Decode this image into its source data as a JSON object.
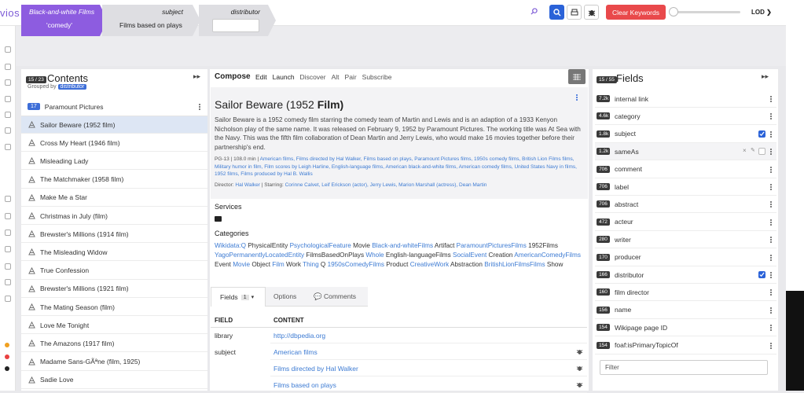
{
  "app": {
    "logo": "vios"
  },
  "topbar": {
    "search_text": "comedy",
    "clear_keywords": "Clear Keywords",
    "lod_label": "LOD"
  },
  "crumbs": [
    {
      "title": "Black-and-white Films",
      "value": "'comedy'"
    },
    {
      "title": "subject",
      "value": "Films based on plays"
    },
    {
      "title": "distributor",
      "value": ""
    }
  ],
  "contents": {
    "count": "15 / 23",
    "title": "Contents",
    "grouped_by_label": "Grouped by",
    "grouped_by_value": "distributor",
    "group": {
      "count": "17",
      "label": "Paramount Pictures"
    },
    "items": [
      "Sailor Beware (1952 film)",
      "Cross My Heart (1946 film)",
      "Misleading Lady",
      "The Matchmaker (1958 film)",
      "Make Me a Star",
      "Christmas in July (film)",
      "Brewster's Millions (1914 film)",
      "The Misleading Widow",
      "True Confession",
      "Brewster's Millions (1921 film)",
      "The Mating Season (film)",
      "Love Me Tonight",
      "The Amazons (1917 film)",
      "Madame Sans-GÃªne (film, 1925)",
      "Sadie Love"
    ]
  },
  "compose": {
    "title": "Compose",
    "tabs": [
      "Edit",
      "Launch",
      "Discover",
      "Alt",
      "Pair",
      "Subscribe"
    ],
    "heading_plain": "Sailor Beware (1952 ",
    "heading_bold": "Film)",
    "abstract": "Sailor Beware is a 1952 comedy film starring the comedy team of Martin and Lewis and is an adaption of a 1933 Kenyon Nicholson play of the same name. It was released on February 9, 1952 by Paramount Pictures. The working title was At Sea with the Navy. This was the fifth film collaboration of Dean Martin and Jerry Lewis, who would make 16 movies together before their partnership's end.",
    "meta_prefix": "PG-13 | 108.0 min | ",
    "meta_links": "American films, Films directed by Hal Walker, Films based on plays, Paramount Pictures films, 1950s comedy films, British Lion Films films, Military humor in film, Film scores by Leigh Harline, English-language films, American black-and-white films, American comedy films, United States Navy in films, 1952 films, Films produced by Hal B. Wallis",
    "director_label": "Director: ",
    "director": "Hal Walker",
    "starring_label": " | Starring: ",
    "starring": "Corinne Calvet, Leif Erickson (actor), Jerry Lewis, Marion Marshall (actress), Dean Martin",
    "services_label": "Services",
    "categories_label": "Categories",
    "categories": [
      {
        "t": "Wikidata:Q",
        "l": true
      },
      {
        "t": "PhysicalEntity",
        "l": false
      },
      {
        "t": "PsychologicalFeature",
        "l": true
      },
      {
        "t": "Movie",
        "l": false
      },
      {
        "t": "Black-and-whiteFilms",
        "l": true
      },
      {
        "t": "Artifact",
        "l": false
      },
      {
        "t": "ParamountPicturesFilms",
        "l": true
      },
      {
        "t": "1952Films",
        "l": false
      },
      {
        "t": "YagoPermanentlyLocatedEntity",
        "l": true
      },
      {
        "t": "FilmsBasedOnPlays",
        "l": false
      },
      {
        "t": "Whole",
        "l": true
      },
      {
        "t": "English-languageFilms",
        "l": false
      },
      {
        "t": "SocialEvent",
        "l": true
      },
      {
        "t": "Creation",
        "l": false
      },
      {
        "t": "AmericanComedyFilms",
        "l": true
      },
      {
        "t": "Event",
        "l": false
      },
      {
        "t": "Movie",
        "l": true
      },
      {
        "t": "Object",
        "l": false
      },
      {
        "t": "Film",
        "l": true
      },
      {
        "t": "Work",
        "l": false
      },
      {
        "t": "Thing",
        "l": true
      },
      {
        "t": "Q",
        "l": false
      },
      {
        "t": "1950sComedyFilms",
        "l": true
      },
      {
        "t": "Product",
        "l": false
      },
      {
        "t": "CreativeWork",
        "l": true
      },
      {
        "t": "Abstraction",
        "l": false
      },
      {
        "t": "BritishLionFilmsFilms",
        "l": true
      },
      {
        "t": "Show",
        "l": false
      }
    ],
    "subtabs": {
      "fields": "Fields",
      "fields_count": "1",
      "options": "Options",
      "comments": "Comments"
    },
    "table": {
      "col_field": "FIELD",
      "col_content": "CONTENT",
      "rows": [
        {
          "field": "library",
          "content": "http://dbpedia.org"
        },
        {
          "field": "subject",
          "content": "American films"
        },
        {
          "field": "",
          "content": "Films directed by Hal Walker"
        },
        {
          "field": "",
          "content": "Films based on plays"
        }
      ]
    }
  },
  "fields": {
    "count": "15 / 55",
    "title": "Fields",
    "items": [
      {
        "count": "7.2k",
        "name": "internal link",
        "checked": null
      },
      {
        "count": "4.6k",
        "name": "category",
        "checked": null
      },
      {
        "count": "1.8k",
        "name": "subject",
        "checked": true
      },
      {
        "count": "1.2k",
        "name": "sameAs",
        "checked": false
      },
      {
        "count": "706",
        "name": "comment",
        "checked": null
      },
      {
        "count": "706",
        "name": "label",
        "checked": null
      },
      {
        "count": "706",
        "name": "abstract",
        "checked": null
      },
      {
        "count": "472",
        "name": "acteur",
        "checked": null
      },
      {
        "count": "280",
        "name": "writer",
        "checked": null
      },
      {
        "count": "170",
        "name": "producer",
        "checked": null
      },
      {
        "count": "166",
        "name": "distributor",
        "checked": true
      },
      {
        "count": "160",
        "name": "film director",
        "checked": null
      },
      {
        "count": "156",
        "name": "name",
        "checked": null
      },
      {
        "count": "154",
        "name": "Wikipage page ID",
        "checked": null
      },
      {
        "count": "154",
        "name": "foaf:isPrimaryTopicOf",
        "checked": null
      }
    ],
    "filter_placeholder": "Filter"
  },
  "colors": {
    "accent": "#7d5bd6",
    "primary": "#2a62d8",
    "danger": "#e9494b",
    "link": "#3d7bd3"
  }
}
